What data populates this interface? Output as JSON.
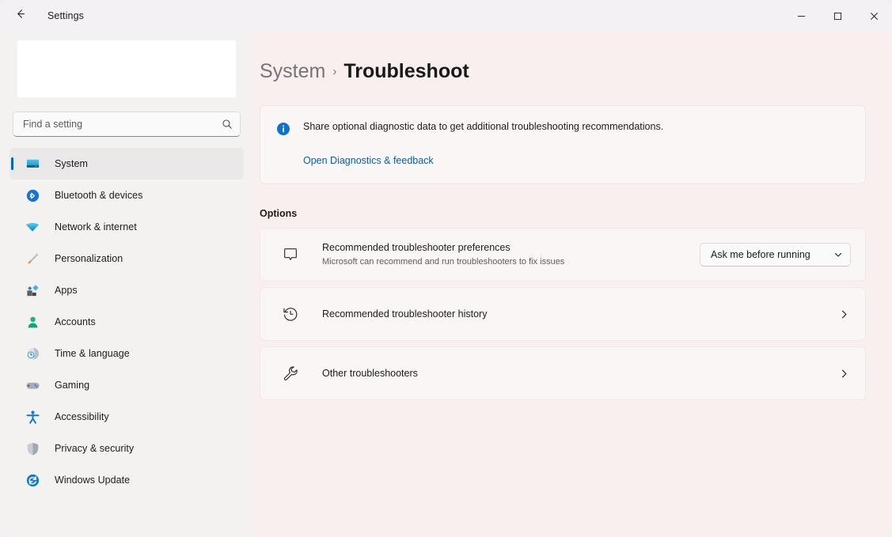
{
  "window": {
    "app_title": "Settings",
    "back_icon": "back-arrow-icon",
    "minimize_label": "Minimize",
    "maximize_label": "Maximize",
    "close_label": "Close"
  },
  "sidebar": {
    "search": {
      "placeholder": "Find a setting",
      "value": "",
      "icon": "search-icon"
    },
    "items": [
      {
        "label": "System",
        "icon": "monitor-icon",
        "selected": true
      },
      {
        "label": "Bluetooth & devices",
        "icon": "bluetooth-icon",
        "selected": false
      },
      {
        "label": "Network & internet",
        "icon": "wifi-icon",
        "selected": false
      },
      {
        "label": "Personalization",
        "icon": "paintbrush-icon",
        "selected": false
      },
      {
        "label": "Apps",
        "icon": "apps-icon",
        "selected": false
      },
      {
        "label": "Accounts",
        "icon": "person-icon",
        "selected": false
      },
      {
        "label": "Time & language",
        "icon": "clock-globe-icon",
        "selected": false
      },
      {
        "label": "Gaming",
        "icon": "gamepad-icon",
        "selected": false
      },
      {
        "label": "Accessibility",
        "icon": "accessibility-person-icon",
        "selected": false
      },
      {
        "label": "Privacy & security",
        "icon": "shield-icon",
        "selected": false
      },
      {
        "label": "Windows Update",
        "icon": "update-refresh-icon",
        "selected": false
      }
    ]
  },
  "main": {
    "breadcrumb": {
      "parent": "System",
      "separator": "›",
      "current": "Troubleshoot"
    },
    "info_banner": {
      "icon": "info-circle-icon",
      "text": "Share optional diagnostic data to get additional troubleshooting recommendations.",
      "link": "Open Diagnostics & feedback"
    },
    "options_heading": "Options",
    "options": [
      {
        "icon": "chat-bubble-icon",
        "title": "Recommended troubleshooter preferences",
        "subtitle": "Microsoft can recommend and run troubleshooters to fix issues",
        "control": "dropdown",
        "dropdown_value": "Ask me before running",
        "dropdown_icon": "chevron-down-icon"
      },
      {
        "icon": "history-icon",
        "title": "Recommended troubleshooter history",
        "subtitle": "",
        "control": "chevron",
        "chevron_icon": "chevron-right-icon"
      },
      {
        "icon": "wrench-icon",
        "title": "Other troubleshooters",
        "subtitle": "",
        "control": "chevron",
        "chevron_icon": "chevron-right-icon"
      }
    ]
  },
  "colors": {
    "accent": "#0067c0",
    "link": "#0d5bab",
    "info_icon": "#0b72d4",
    "page_bg": "#f9efee",
    "sidebar_bg": "#f4f1f1",
    "card_bg": "#fbf6f6"
  }
}
